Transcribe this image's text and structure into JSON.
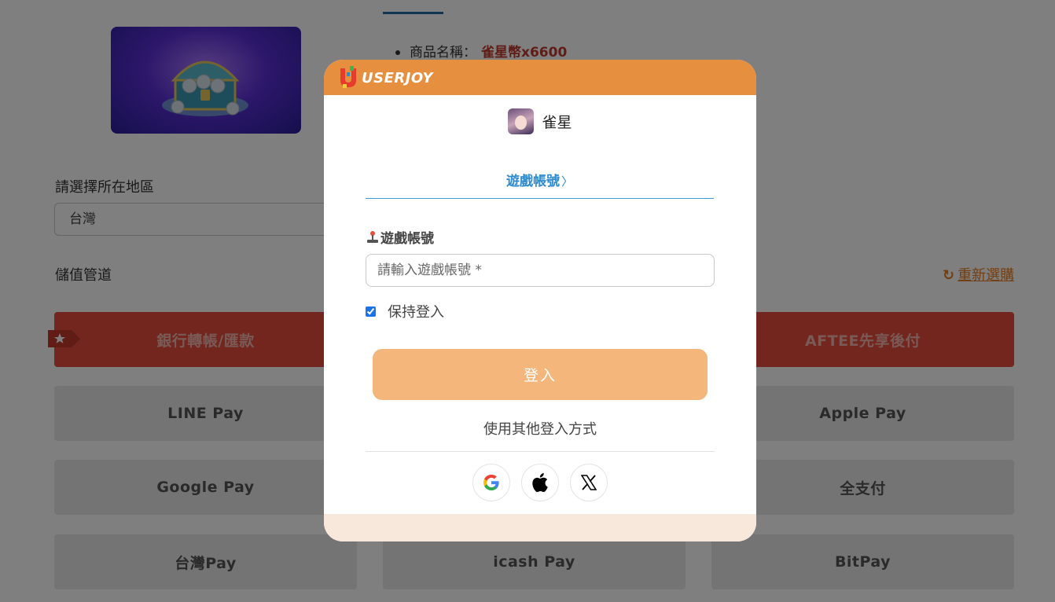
{
  "product": {
    "name_label": "商品名稱：",
    "name_value": "雀星幣x6600"
  },
  "region": {
    "label": "請選擇所在地區",
    "selected": "台灣"
  },
  "channel": {
    "label": "儲值管道",
    "reselect_label": "重新選購"
  },
  "payment_methods": [
    {
      "label": "銀行轉帳/匯款"
    },
    {
      "label": "AFTEE先享後付"
    },
    {
      "label": "LINE Pay"
    },
    {
      "label": "Apple Pay"
    },
    {
      "label": "Google Pay"
    },
    {
      "label": "全支付"
    },
    {
      "label": "台灣Pay"
    },
    {
      "label": "icash Pay"
    },
    {
      "label": "BitPay"
    }
  ],
  "modal": {
    "brand": "USERJOY",
    "game_name": "雀星",
    "tab_label": "遊戲帳號",
    "field_label": "遊戲帳號",
    "account_placeholder": "請輸入遊戲帳號 *",
    "account_value": "",
    "keep_login_label": "保持登入",
    "keep_login_checked": true,
    "login_button": "登入",
    "other_login_label": "使用其他登入方式",
    "social": [
      "google-icon",
      "apple-icon",
      "x-icon"
    ]
  },
  "colors": {
    "header": "#e68f3f",
    "login_button": "#f5b67b",
    "tab_accent": "#2e8bcf",
    "primary_payment": "#e74c3c",
    "price_text": "#c0392b",
    "reselect_text": "#e67e22"
  }
}
